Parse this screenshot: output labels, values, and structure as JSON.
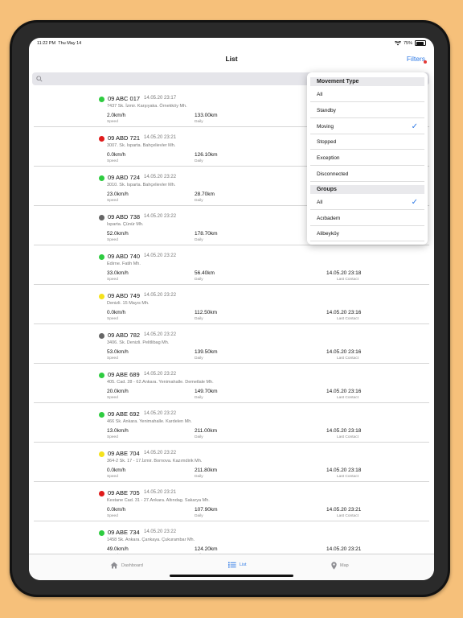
{
  "status_bar": {
    "time": "11:22 PM",
    "date": "Thu May 14",
    "battery": "75%",
    "icons": [
      "wifi-icon",
      "battery-icon"
    ]
  },
  "nav": {
    "title": "List",
    "filters_label": "Filters"
  },
  "search": {
    "placeholder": ""
  },
  "list": {
    "items": [
      {
        "plate": "09 ABC 017",
        "timestamp": "14.05.20 23:17",
        "address": "7437 Sk. İzmir. Karşıyaka. Örnekköy Mh.",
        "speed": "2.0km/h",
        "daily": "133.00km",
        "last_contact": "",
        "status_color": "#2ecc40"
      },
      {
        "plate": "09 ABD 721",
        "timestamp": "14.05.20 23:21",
        "address": "3007. Sk. Isparta. Bahçelievler Mh.",
        "speed": "0.0km/h",
        "daily": "126.10km",
        "last_contact": "",
        "status_color": "#e01b1b"
      },
      {
        "plate": "09 ABD 724",
        "timestamp": "14.05.20 23:22",
        "address": "3010. Sk. Isparta. Bahçelievler Mh.",
        "speed": "23.0km/h",
        "daily": "28.70km",
        "last_contact": "",
        "status_color": "#2ecc40"
      },
      {
        "plate": "09 ABD 738",
        "timestamp": "14.05.20 23:22",
        "address": "Isparta. Çünür Mh.",
        "speed": "52.0km/h",
        "daily": "178.70km",
        "last_contact": "",
        "status_color": "#666666"
      },
      {
        "plate": "09 ABD 740",
        "timestamp": "14.05.20 23:22",
        "address": "Edirne. Fatih Mh.",
        "speed": "33.0km/h",
        "daily": "56.40km",
        "last_contact": "14.05.20 23:18",
        "status_color": "#2ecc40"
      },
      {
        "plate": "09 ABD 749",
        "timestamp": "14.05.20 23:22",
        "address": "Denizli. 15 Mayıs Mh.",
        "speed": "0.0km/h",
        "daily": "112.50km",
        "last_contact": "14.05.20 23:16",
        "status_color": "#f5e21b"
      },
      {
        "plate": "09 ABD 782",
        "timestamp": "14.05.20 23:22",
        "address": "3406. Sk. Denizli. Pelitlibag Mh.",
        "speed": "53.0km/h",
        "daily": "139.50km",
        "last_contact": "14.05.20 23:16",
        "status_color": "#666666"
      },
      {
        "plate": "09 ABE 689",
        "timestamp": "14.05.20 23:22",
        "address": "405. Cad. 28 - 62.Ankara. Yenimahalle. Demetlale Mh.",
        "speed": "20.0km/h",
        "daily": "149.70km",
        "last_contact": "14.05.20 23:16",
        "status_color": "#2ecc40"
      },
      {
        "plate": "09 ABE 692",
        "timestamp": "14.05.20 23:22",
        "address": "466 Sk. Ankara. Yenimahalle. Kardelen Mh.",
        "speed": "13.0km/h",
        "daily": "211.00km",
        "last_contact": "14.05.20 23:18",
        "status_color": "#2ecc40"
      },
      {
        "plate": "09 ABE 704",
        "timestamp": "14.05.20 23:22",
        "address": "364-2 Sk. 17 - 17.İzmir. Bornova. Kazımdirik Mh.",
        "speed": "0.0km/h",
        "daily": "211.80km",
        "last_contact": "14.05.20 23:18",
        "status_color": "#f5e21b"
      },
      {
        "plate": "09 ABE 705",
        "timestamp": "14.05.20 23:21",
        "address": "Kestane Cad. 31 - 27.Ankara. Altındag. Sakarya Mh.",
        "speed": "0.0km/h",
        "daily": "107.90km",
        "last_contact": "14.05.20 23:21",
        "status_color": "#e01b1b"
      },
      {
        "plate": "09 ABE 734",
        "timestamp": "14.05.20 23:22",
        "address": "1458 Sk. Ankara. Çankaya. Çukurambar Mh.",
        "speed": "49.0km/h",
        "daily": "124.20km",
        "last_contact": "14.05.20 23:21",
        "status_color": "#2ecc40"
      }
    ],
    "labels": {
      "speed": "Speed",
      "daily": "Daily",
      "last_contact": "Last Contact"
    }
  },
  "popover": {
    "movement_header": "Movement Type",
    "movement_options": [
      {
        "label": "All",
        "selected": false
      },
      {
        "label": "Standby",
        "selected": false
      },
      {
        "label": "Moving",
        "selected": true
      },
      {
        "label": "Stopped",
        "selected": false
      },
      {
        "label": "Exception",
        "selected": false
      },
      {
        "label": "Disconnected",
        "selected": false
      }
    ],
    "groups_header": "Groups",
    "group_options": [
      {
        "label": "All",
        "selected": true
      },
      {
        "label": "Acıbadem",
        "selected": false
      },
      {
        "label": "Alibeyköy",
        "selected": false
      }
    ]
  },
  "tabbar": {
    "tabs": [
      {
        "label": "Dashboard",
        "icon": "home-icon"
      },
      {
        "label": "List",
        "icon": "list-icon",
        "active": true
      },
      {
        "label": "Map",
        "icon": "map-pin-icon"
      }
    ]
  },
  "colors": {
    "accent": "#2f7ae5",
    "device_bg": "#f6c07a"
  }
}
